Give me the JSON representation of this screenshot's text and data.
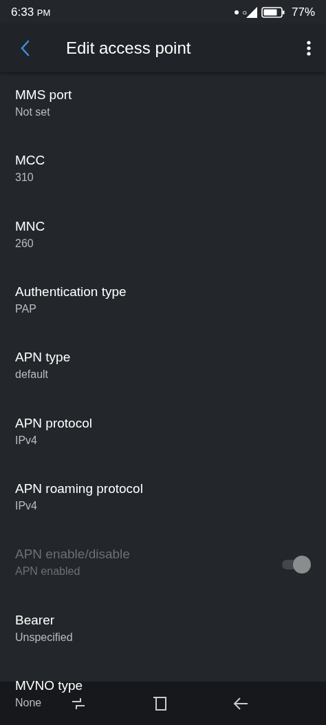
{
  "status_bar": {
    "time": "6:33",
    "ampm": "PM",
    "network": "G",
    "battery": "77%"
  },
  "app_bar": {
    "title": "Edit access point"
  },
  "settings": [
    {
      "kind": "text",
      "title": "MMS port",
      "summary": "Not set",
      "disabled": false
    },
    {
      "kind": "text",
      "title": "MCC",
      "summary": "310",
      "disabled": false
    },
    {
      "kind": "text",
      "title": "MNC",
      "summary": "260",
      "disabled": false
    },
    {
      "kind": "text",
      "title": "Authentication type",
      "summary": "PAP",
      "disabled": false
    },
    {
      "kind": "text",
      "title": "APN type",
      "summary": "default",
      "disabled": false
    },
    {
      "kind": "text",
      "title": "APN protocol",
      "summary": "IPv4",
      "disabled": false
    },
    {
      "kind": "text",
      "title": "APN roaming protocol",
      "summary": "IPv4",
      "disabled": false
    },
    {
      "kind": "switch",
      "title": "APN enable/disable",
      "summary": "APN enabled",
      "disabled": true,
      "on": true
    },
    {
      "kind": "text",
      "title": "Bearer",
      "summary": "Unspecified",
      "disabled": false
    },
    {
      "kind": "text",
      "title": "MVNO type",
      "summary": "None",
      "disabled": false
    }
  ]
}
